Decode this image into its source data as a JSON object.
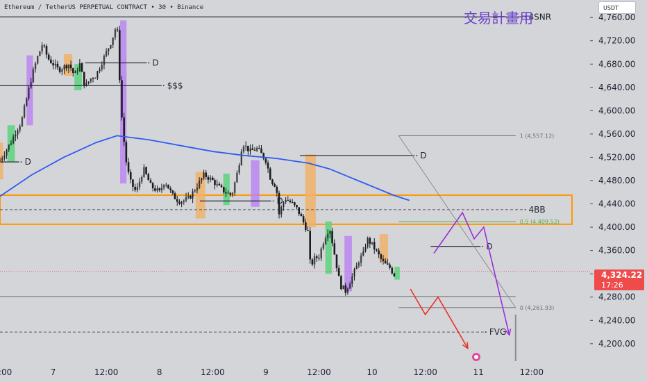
{
  "header": {
    "symbol_line": "Ethereum / TetherUS PERPETUAL CONTRACT • 30 • Binance",
    "plan_title": "交易計畫用",
    "currency": "USDT"
  },
  "last_price": {
    "value": "4,324.22",
    "countdown": "17:26"
  },
  "chart_data": {
    "type": "candlestick",
    "title": "",
    "xlabel": "",
    "ylabel": "",
    "x_axis": {
      "unit": "day",
      "range": [
        6.0,
        11.55
      ],
      "ticks": [
        {
          "x": 6.0,
          "label": "12:00"
        },
        {
          "x": 6.5,
          "label": "7"
        },
        {
          "x": 7.0,
          "label": "12:00"
        },
        {
          "x": 7.5,
          "label": "8"
        },
        {
          "x": 8.0,
          "label": "12:00"
        },
        {
          "x": 8.5,
          "label": "9"
        },
        {
          "x": 9.0,
          "label": "12:00"
        },
        {
          "x": 9.5,
          "label": "10"
        },
        {
          "x": 10.0,
          "label": "12:00"
        },
        {
          "x": 10.5,
          "label": "11"
        },
        {
          "x": 11.0,
          "label": "12:00"
        }
      ]
    },
    "y_axis": {
      "range": [
        4170,
        4790
      ],
      "ticks": [
        4200,
        4240,
        4280,
        4320,
        4360,
        4400,
        4440,
        4480,
        4520,
        4560,
        4600,
        4640,
        4680,
        4720,
        4760
      ],
      "labels": [
        "4,200.00",
        "4,240.00",
        "4,280.00",
        "4,320.00",
        "4,360.00",
        "4,400.00",
        "4,440.00",
        "4,480.00",
        "4,520.00",
        "4,560.00",
        "4,600.00",
        "4,640.00",
        "4,680.00",
        "4,720.00",
        "4,760.00"
      ]
    },
    "grid": false,
    "close_path": [
      [
        6.0,
        4515
      ],
      [
        6.05,
        4530
      ],
      [
        6.1,
        4545
      ],
      [
        6.15,
        4565
      ],
      [
        6.2,
        4580
      ],
      [
        6.25,
        4620
      ],
      [
        6.3,
        4660
      ],
      [
        6.35,
        4690
      ],
      [
        6.4,
        4715
      ],
      [
        6.45,
        4690
      ],
      [
        6.5,
        4680
      ],
      [
        6.55,
        4670
      ],
      [
        6.6,
        4675
      ],
      [
        6.65,
        4680
      ],
      [
        6.7,
        4660
      ],
      [
        6.75,
        4680
      ],
      [
        6.8,
        4640
      ],
      [
        6.85,
        4655
      ],
      [
        6.9,
        4660
      ],
      [
        6.95,
        4680
      ],
      [
        7.0,
        4700
      ],
      [
        7.05,
        4720
      ],
      [
        7.1,
        4750
      ],
      [
        7.14,
        4600
      ],
      [
        7.18,
        4520
      ],
      [
        7.22,
        4480
      ],
      [
        7.28,
        4460
      ],
      [
        7.35,
        4500
      ],
      [
        7.42,
        4470
      ],
      [
        7.5,
        4460
      ],
      [
        7.55,
        4480
      ],
      [
        7.62,
        4455
      ],
      [
        7.68,
        4445
      ],
      [
        7.72,
        4445
      ],
      [
        7.78,
        4450
      ],
      [
        7.85,
        4470
      ],
      [
        7.92,
        4490
      ],
      [
        8.0,
        4480
      ],
      [
        8.05,
        4470
      ],
      [
        8.12,
        4460
      ],
      [
        8.18,
        4455
      ],
      [
        8.24,
        4500
      ],
      [
        8.28,
        4545
      ],
      [
        8.35,
        4530
      ],
      [
        8.42,
        4535
      ],
      [
        8.48,
        4520
      ],
      [
        8.5,
        4515
      ],
      [
        8.55,
        4480
      ],
      [
        8.6,
        4470
      ],
      [
        8.62,
        4420
      ],
      [
        8.68,
        4450
      ],
      [
        8.75,
        4440
      ],
      [
        8.8,
        4430
      ],
      [
        8.85,
        4410
      ],
      [
        8.9,
        4390
      ],
      [
        8.92,
        4330
      ],
      [
        8.95,
        4345
      ],
      [
        9.0,
        4350
      ],
      [
        9.05,
        4380
      ],
      [
        9.1,
        4400
      ],
      [
        9.15,
        4350
      ],
      [
        9.2,
        4300
      ],
      [
        9.23,
        4295
      ],
      [
        9.25,
        4290
      ],
      [
        9.3,
        4310
      ],
      [
        9.35,
        4330
      ],
      [
        9.38,
        4345
      ],
      [
        9.42,
        4355
      ],
      [
        9.45,
        4380
      ],
      [
        9.5,
        4370
      ],
      [
        9.55,
        4355
      ],
      [
        9.6,
        4340
      ],
      [
        9.63,
        4335
      ],
      [
        9.67,
        4330
      ],
      [
        9.7,
        4320
      ],
      [
        9.72,
        4316
      ]
    ],
    "candle_range": [
      6.0,
      9.72
    ],
    "series": [
      {
        "type": "line",
        "color": "#2e5cf0",
        "points": [
          [
            6.0,
            4453
          ],
          [
            6.3,
            4490
          ],
          [
            6.6,
            4520
          ],
          [
            6.9,
            4545
          ],
          [
            7.1,
            4557
          ],
          [
            7.4,
            4550
          ],
          [
            7.7,
            4540
          ],
          [
            8.0,
            4530
          ],
          [
            8.3,
            4523
          ],
          [
            8.6,
            4518
          ],
          [
            8.9,
            4510
          ],
          [
            9.1,
            4500
          ],
          [
            9.3,
            4485
          ],
          [
            9.5,
            4470
          ],
          [
            9.7,
            4455
          ],
          [
            9.85,
            4446
          ]
        ]
      }
    ],
    "horizontal_lines": [
      {
        "label": "4SNR",
        "y": 4761,
        "x0": 6.0,
        "x1": 10.92,
        "style": "solid"
      },
      {
        "label": "D",
        "y": 4682,
        "x0": 6.8,
        "x1": 7.38,
        "style": "solid"
      },
      {
        "label": "$$$",
        "y": 4643,
        "x0": 6.0,
        "x1": 7.52,
        "style": "solid"
      },
      {
        "label": "D",
        "y": 4512,
        "x0": 6.0,
        "x1": 6.18,
        "style": "solid"
      },
      {
        "label": "D",
        "y": 4523,
        "x0": 8.82,
        "x1": 9.9,
        "style": "solid"
      },
      {
        "label": "D",
        "y": 4445,
        "x0": 7.88,
        "x1": 8.55,
        "style": "solid"
      },
      {
        "label": "D",
        "y": 4367,
        "x0": 10.05,
        "x1": 10.52,
        "style": "solid"
      },
      {
        "label": "4BB",
        "y": 4430,
        "x0": 6.0,
        "x1": 10.92,
        "style": "dashed"
      },
      {
        "label": "FVG",
        "y": 4220,
        "x0": 6.0,
        "x1": 10.55,
        "style": "dashed"
      },
      {
        "label": "",
        "y": 4281,
        "x0": 6.0,
        "x1": 10.85,
        "style": "solid-gray"
      }
    ],
    "zones": [
      {
        "color": "#ff9800",
        "x0": 6.0,
        "x1": 11.38,
        "y0": 4405,
        "y1": 4455,
        "style": "outline"
      },
      {
        "color": "#ba86f0",
        "x0": 6.25,
        "x1": 6.31,
        "y0": 4575,
        "y1": 4695
      },
      {
        "color": "#5cd37e",
        "x0": 6.07,
        "x1": 6.14,
        "y0": 4513,
        "y1": 4575
      },
      {
        "color": "#f0b16a",
        "x0": 6.0,
        "x1": 6.03,
        "y0": 4482,
        "y1": 4545
      },
      {
        "color": "#f0b16a",
        "x0": 6.6,
        "x1": 6.68,
        "y0": 4660,
        "y1": 4697
      },
      {
        "color": "#5cd37e",
        "x0": 6.7,
        "x1": 6.77,
        "y0": 4635,
        "y1": 4680
      },
      {
        "color": "#ba86f0",
        "x0": 7.13,
        "x1": 7.19,
        "y0": 4475,
        "y1": 4755
      },
      {
        "color": "#f0b16a",
        "x0": 7.84,
        "x1": 7.93,
        "y0": 4415,
        "y1": 4495
      },
      {
        "color": "#5cd37e",
        "x0": 8.1,
        "x1": 8.16,
        "y0": 4438,
        "y1": 4492
      },
      {
        "color": "#ba86f0",
        "x0": 8.36,
        "x1": 8.44,
        "y0": 4435,
        "y1": 4515
      },
      {
        "color": "#f0b16a",
        "x0": 8.87,
        "x1": 8.97,
        "y0": 4400,
        "y1": 4525
      },
      {
        "color": "#5cd37e",
        "x0": 9.06,
        "x1": 9.12,
        "y0": 4320,
        "y1": 4410
      },
      {
        "color": "#ba86f0",
        "x0": 9.24,
        "x1": 9.31,
        "y0": 4290,
        "y1": 4385
      },
      {
        "color": "#f0b16a",
        "x0": 9.57,
        "x1": 9.65,
        "y0": 4340,
        "y1": 4388
      },
      {
        "color": "#5cd37e",
        "x0": 9.71,
        "x1": 9.76,
        "y0": 4310,
        "y1": 4332
      }
    ],
    "fibonacci": {
      "x0": 9.75,
      "x1": 10.85,
      "levels": [
        {
          "ratio": "1",
          "label": "1 (4,557.12)",
          "y": 4557.12
        },
        {
          "ratio": "0.5",
          "label": "0.5 (4,409.52)",
          "y": 4409.52
        },
        {
          "ratio": "0",
          "label": "0 (4,261.93)",
          "y": 4261.93
        }
      ]
    },
    "projections": [
      {
        "color": "#9b2fd6",
        "points": [
          [
            10.08,
            4355
          ],
          [
            10.35,
            4425
          ],
          [
            10.46,
            4380
          ],
          [
            10.55,
            4400
          ],
          [
            10.79,
            4215
          ]
        ],
        "arrow": true
      },
      {
        "color": "#e8332c",
        "points": [
          [
            9.86,
            4294
          ],
          [
            10.0,
            4250
          ],
          [
            10.12,
            4280
          ],
          [
            10.4,
            4192
          ]
        ],
        "arrow": true
      }
    ],
    "last_price_y": 4324.22
  }
}
